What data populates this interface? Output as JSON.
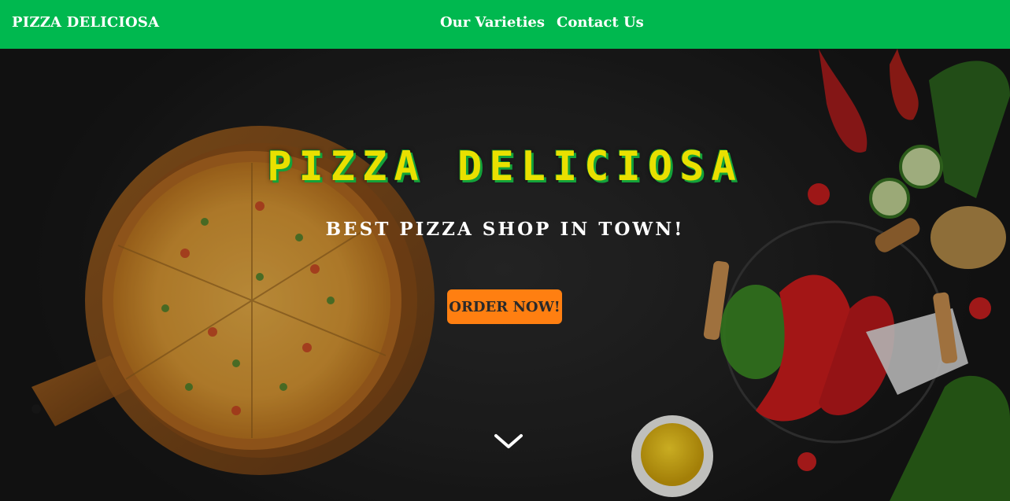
{
  "navbar": {
    "brand": "PIZZA DELICIOSA",
    "links": [
      "Our Varieties",
      "Contact Us"
    ]
  },
  "hero": {
    "title": "PIZZA DELICIOSA",
    "subtitle": "BEST PIZZA SHOP IN TOWN!",
    "cta_label": "ORDER NOW!",
    "scroll_icon": "chevron-down-icon"
  },
  "colors": {
    "navbar_bg": "#00b84f",
    "title": "#e9e000",
    "title_shadow": "#14a23a",
    "cta_bg": "#ff7f11",
    "background": "#1b1b1b"
  }
}
